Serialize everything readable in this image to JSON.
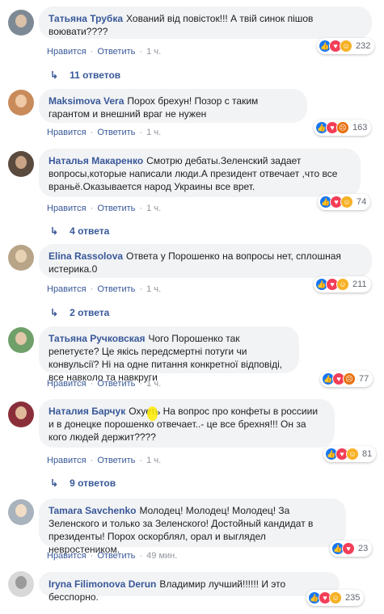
{
  "actions": {
    "like": "Нравится",
    "reply": "Ответить",
    "dot": "·"
  },
  "comments": [
    {
      "author": "Татьяна Трубка",
      "text": "Хований від повісток!!! А твій синок пішов воювати????",
      "reactions": [
        "like",
        "heart",
        "haha"
      ],
      "count": "232",
      "time": "1 ч.",
      "replies": "11 ответов",
      "avatar": {
        "bg": "#7d8a96",
        "face": "#d9c2a8"
      }
    },
    {
      "author": "Maksimova Vera",
      "text": "Порох брехун! Позор с таким гарантом и внешний враг не нужен",
      "reactions": [
        "like",
        "heart",
        "angry"
      ],
      "count": "163",
      "time": "1 ч.",
      "replies": "",
      "avatar": {
        "bg": "#c98b5a",
        "face": "#f0c9a6"
      }
    },
    {
      "author": "Наталья Макаренко",
      "text": "Смотрю дебаты.Зеленский задает вопросы,которые написали люди.А президент отвечает ,что все враньё.Оказывается народ Украины все врет.",
      "reactions": [
        "like",
        "heart",
        "haha"
      ],
      "count": "74",
      "time": "1 ч.",
      "replies": "4 ответа",
      "avatar": {
        "bg": "#5b4a3e",
        "face": "#c9a486"
      }
    },
    {
      "author": "Elina Rassolova",
      "text": "Ответа у Порошенко на вопросы нет, сплошная истерика.0",
      "reactions": [
        "like",
        "heart",
        "haha"
      ],
      "count": "211",
      "time": "1 ч.",
      "replies": "2 ответа",
      "avatar": {
        "bg": "#b8a487",
        "face": "#e8d2b4"
      }
    },
    {
      "author": "Татьяна Ручковская",
      "text": "Чого Порошенко так репетуєте? Це якісь передсмертні потуги чи конвульсії? Ні на одне питання конкретної відповіді, все навколо та навкруги",
      "reactions": [
        "like",
        "heart",
        "angry"
      ],
      "count": "77",
      "time": "1 ч.",
      "replies": "",
      "avatar": {
        "bg": "#6fa06a",
        "face": "#e2c7a8"
      }
    },
    {
      "author": "Наталия Барчук",
      "text": "Охуеть На вопрос про конфеты в россиии и в донецке порошенко отвечает..- це все брехня!!! Он за кого людей держит????",
      "reactions": [
        "like",
        "heart",
        "haha"
      ],
      "count": "81",
      "time": "1 ч.",
      "replies": "9 ответов",
      "avatar": {
        "bg": "#8a2f3a",
        "face": "#e0b99a"
      }
    },
    {
      "author": "Tamara Savchenko",
      "text": "Молодец! Молодец! Молодец! За Зеленского и только за Зеленского! Достойный кандидат в президенты! Порох оскорблял, орал и выглядел невростеником.",
      "reactions": [
        "like",
        "heart"
      ],
      "count": "23",
      "time": "49 мин.",
      "replies": "",
      "avatar": {
        "bg": "#a9b3bd",
        "face": "#f1dcc5"
      }
    },
    {
      "author": "Iryna Filimonova Derun",
      "text": "Владимир лучший!!!!!! И это бесспорно.",
      "reactions": [
        "like",
        "heart",
        "haha"
      ],
      "count": "235",
      "time": "",
      "replies": "",
      "avatar": {
        "bg": "#d8d8d8",
        "face": "#9a9a9a"
      }
    }
  ]
}
